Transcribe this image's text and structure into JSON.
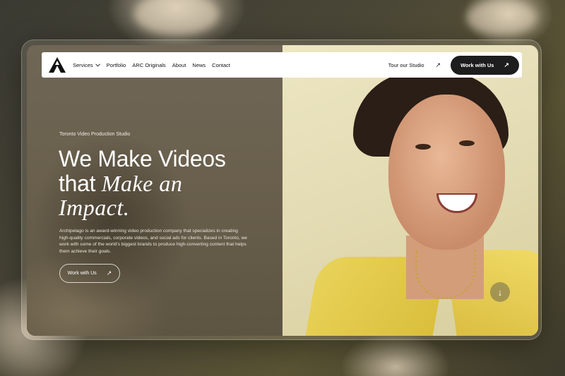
{
  "brand": {
    "logo_letter": "A"
  },
  "nav": {
    "links": [
      {
        "label": "Services",
        "has_dropdown": true
      },
      {
        "label": "Portfolio"
      },
      {
        "label": "ARC Originals"
      },
      {
        "label": "About"
      },
      {
        "label": "News"
      },
      {
        "label": "Contact"
      }
    ],
    "tour_label": "Tour our Studio",
    "work_button_label": "Work with Us"
  },
  "hero": {
    "eyebrow": "Toronto Video Production Studio",
    "headline_line1": "We Make Videos",
    "headline_line2_plain": "that ",
    "headline_line2_italic": "Make an",
    "headline_line3_italic": "Impact.",
    "body": "Archipelago is an award-winning video production company that specializes in creating high-quality commercials, corporate videos, and social ads for clients. Based in Toronto, we work with some of the world's biggest brands to produce high-converting content that helps them achieve their goals.",
    "cta_label": "Work with Us"
  },
  "icons": {
    "arrow_up_right": "↗",
    "arrow_down": "↓",
    "chevron_down": "⌄"
  },
  "colors": {
    "nav_bg": "#ffffff",
    "button_dark": "#1d1d1d",
    "hero_left_bg": "#6b6250",
    "shirt_yellow": "#e9d35a"
  }
}
